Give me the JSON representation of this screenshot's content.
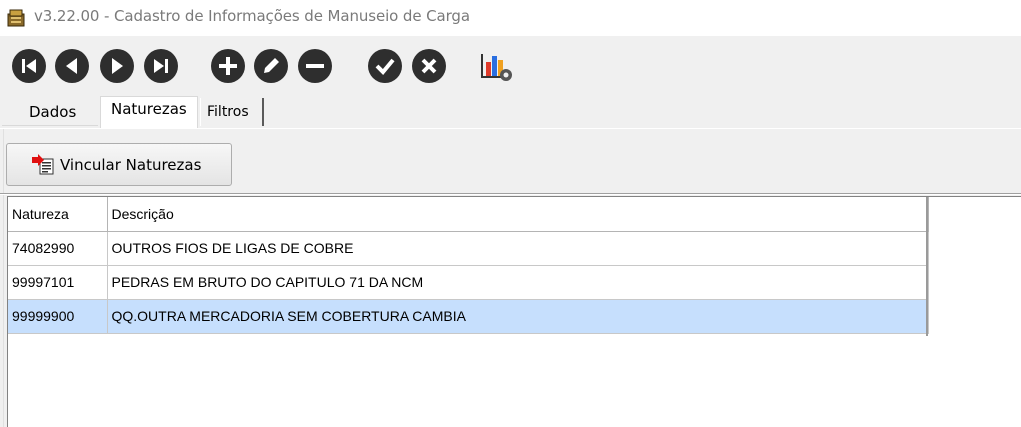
{
  "window": {
    "title": "v3.22.00 - Cadastro de Informações de Manuseio de Carga",
    "app_icon": "cargo-box-icon"
  },
  "toolbar": {
    "buttons": [
      {
        "name": "first-record-icon"
      },
      {
        "name": "previous-record-icon"
      },
      {
        "name": "next-record-icon"
      },
      {
        "name": "last-record-icon"
      },
      {
        "name": "add-icon"
      },
      {
        "name": "edit-icon"
      },
      {
        "name": "remove-icon"
      },
      {
        "name": "confirm-icon"
      },
      {
        "name": "cancel-icon"
      },
      {
        "name": "chart-settings-icon"
      }
    ]
  },
  "tabs": [
    {
      "label": "Dados",
      "active": false
    },
    {
      "label": "Naturezas",
      "active": true
    },
    {
      "label": "Filtros",
      "active": false
    }
  ],
  "panel": {
    "vincular_label": "Vincular Naturezas"
  },
  "grid": {
    "columns": [
      "Natureza",
      "Descrição"
    ],
    "rows": [
      {
        "natureza": "74082990",
        "descricao": "OUTROS FIOS DE LIGAS DE COBRE",
        "selected": false
      },
      {
        "natureza": "99997101",
        "descricao": "PEDRAS EM BRUTO DO CAPITULO 71 DA NCM",
        "selected": false
      },
      {
        "natureza": "99999900",
        "descricao": "QQ.OUTRA MERCADORIA SEM COBERTURA CAMBIA",
        "selected": true
      }
    ],
    "selected_color": "#c6dffd"
  }
}
